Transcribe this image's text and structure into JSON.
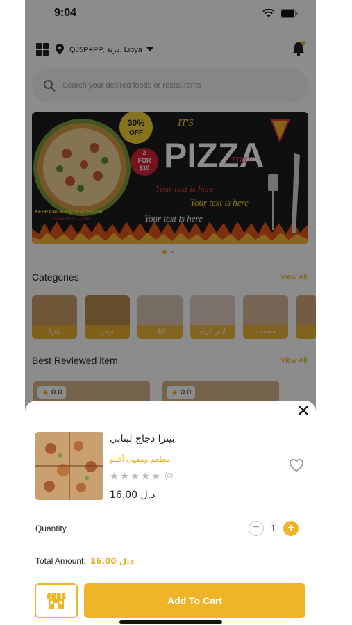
{
  "status_bar": {
    "time": "9:04"
  },
  "header": {
    "location": "QJ5P+PP, درنة, Libya"
  },
  "search": {
    "placeholder": "Search your desired foods or restaurants"
  },
  "banner": {
    "badge_percent": "30%",
    "badge_off": "OFF",
    "deal_line1": "2",
    "deal_line2": "FOR",
    "deal_line3": "$10",
    "its": "IT'S",
    "pizza": "PIZZA",
    "time": "TIME",
    "text1": "Your text is here",
    "text2": "Your text is here",
    "text3": "Your text is here",
    "slogan1": "KEEP CALM AND EAT PIZZA!",
    "slogan2": "MADE WITH LOVE!"
  },
  "categories": {
    "title": "Categories",
    "view_all": "View All",
    "items": [
      {
        "label": "بيتزا",
        "color": "#c9a068"
      },
      {
        "label": "برجر",
        "color": "#b98a4e"
      },
      {
        "label": "كيك",
        "color": "#d9c7b3"
      },
      {
        "label": "آيس كريم",
        "color": "#e3cfc4"
      },
      {
        "label": "معجنات",
        "color": "#d7b89a"
      },
      {
        "label": "",
        "color": "#d2a878"
      }
    ]
  },
  "best_reviewed": {
    "title": "Best Reviewed item",
    "view_all": "View All",
    "items": [
      {
        "rating": "0.0"
      },
      {
        "rating": "0.0"
      }
    ]
  },
  "sheet": {
    "product_name": "بيتزا دجاج لبناني",
    "restaurant": "مطعم ومقهى أفينو",
    "review_count": "(0)",
    "price": "16.00 د.ل",
    "quantity_label": "Quantity",
    "quantity": "1",
    "total_label": "Total Amount:",
    "total_value": "16.00 د.ل",
    "add_to_cart": "Add To Cart"
  },
  "colors": {
    "accent": "#f0b429",
    "accent_text": "#e8b21f"
  },
  "icons": [
    "wifi-icon",
    "battery-icon",
    "grid-icon",
    "location-pin-icon",
    "bell-icon",
    "search-icon",
    "close-icon",
    "heart-icon",
    "star-icon",
    "minus-icon",
    "plus-icon",
    "store-icon"
  ]
}
